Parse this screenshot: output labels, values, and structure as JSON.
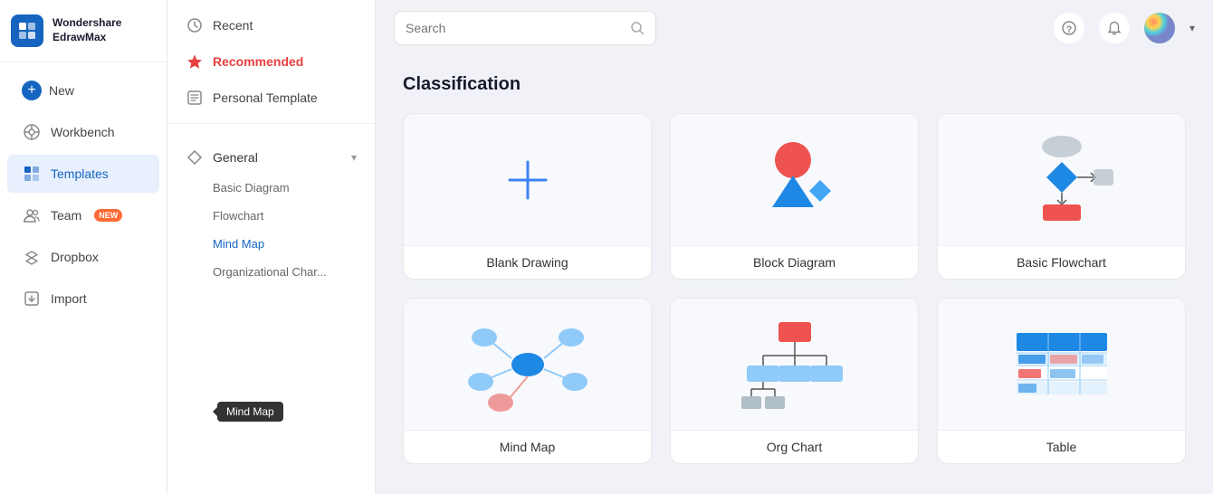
{
  "app": {
    "name_line1": "Wondershare",
    "name_line2": "EdrawMax"
  },
  "left_nav": {
    "new_label": "New",
    "workbench_label": "Workbench",
    "templates_label": "Templates",
    "team_label": "Team",
    "team_badge": "NEW",
    "dropbox_label": "Dropbox",
    "import_label": "Import"
  },
  "second_panel": {
    "recent_label": "Recent",
    "recommended_label": "Recommended",
    "personal_template_label": "Personal Template",
    "general_label": "General",
    "basic_diagram_label": "Basic Diagram",
    "flowchart_label": "Flowchart",
    "mind_map_label": "Mind Map",
    "org_chart_label": "Organizational Char...",
    "tooltip_label": "Mind Map"
  },
  "search": {
    "placeholder": "Search"
  },
  "main": {
    "section_title": "Classification",
    "cards": [
      {
        "label": "Blank Drawing",
        "type": "blank"
      },
      {
        "label": "Block Diagram",
        "type": "block"
      },
      {
        "label": "Basic Flowchart",
        "type": "flowchart"
      },
      {
        "label": "Mind Map",
        "type": "mindmap"
      },
      {
        "label": "Org Chart",
        "type": "orgchart"
      },
      {
        "label": "Table",
        "type": "table"
      }
    ]
  }
}
